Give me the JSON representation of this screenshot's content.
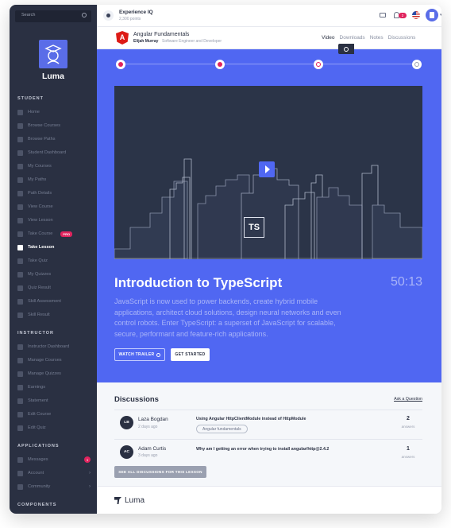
{
  "sidebar": {
    "search_placeholder": "Search",
    "logo_name": "Luma",
    "sections": {
      "student": "STUDENT",
      "instructor": "INSTRUCTOR",
      "applications": "APPLICATIONS",
      "components": "COMPONENTS"
    },
    "student_items": [
      {
        "label": "Home"
      },
      {
        "label": "Browse Courses"
      },
      {
        "label": "Browse Paths"
      },
      {
        "label": "Student Dashboard"
      },
      {
        "label": "My Courses"
      },
      {
        "label": "My Paths"
      },
      {
        "label": "Path Details"
      },
      {
        "label": "View Course"
      },
      {
        "label": "View Lesson"
      },
      {
        "label": "Take Course",
        "badge": "PRO"
      },
      {
        "label": "Take Lesson",
        "active": true
      },
      {
        "label": "Take Quiz"
      },
      {
        "label": "My Quizzes"
      },
      {
        "label": "Quiz Result"
      },
      {
        "label": "Skill Assessment"
      },
      {
        "label": "Skill Result"
      }
    ],
    "instructor_items": [
      {
        "label": "Instructor Dashboard"
      },
      {
        "label": "Manage Courses"
      },
      {
        "label": "Manage Quizzes"
      },
      {
        "label": "Earnings"
      },
      {
        "label": "Statement"
      },
      {
        "label": "Edit Course"
      },
      {
        "label": "Edit Quiz"
      }
    ],
    "application_items": [
      {
        "label": "Messages",
        "count": "3"
      },
      {
        "label": "Account"
      },
      {
        "label": "Community"
      }
    ]
  },
  "topbar": {
    "brand_title": "Experience IQ",
    "brand_sub": "2,300 points",
    "notification_count": "2"
  },
  "lesson": {
    "logo_letter": "A",
    "course_title": "Angular Fundamentals",
    "author": "Elijah Murray",
    "author_role": "Software Engineer and Developer",
    "tabs": [
      "Video",
      "Downloads",
      "Notes",
      "Discussions"
    ]
  },
  "hero": {
    "ts_label": "TS",
    "title": "Introduction to TypeScript",
    "duration": "50:13",
    "description": "JavaScript is now used to power backends, create hybrid mobile applications, architect cloud solutions, design neural networks and even control robots. Enter TypeScript: a superset of JavaScript for scalable, secure, performant and feature-rich applications.",
    "watch_trailer": "WATCH TRAILER",
    "get_started": "GET STARTED"
  },
  "discussions": {
    "title": "Discussions",
    "ask": "Ask a Question",
    "items": [
      {
        "initials": "LB",
        "name": "Laza Bogdan",
        "time": "2 days ago",
        "question": "Using Angular HttpClientModule instead of HttpModule",
        "tag": "Angular fundamentals",
        "count": "2",
        "count_label": "answers"
      },
      {
        "initials": "AC",
        "name": "Adam Curtis",
        "time": "3 days ago",
        "question": "Why am I getting an error when trying to install angular/http@2.4.2",
        "count": "1",
        "count_label": "answers"
      }
    ],
    "see_all": "SEE ALL DISCUSSIONS FOR THIS LESSON"
  },
  "footer": {
    "logo": "Luma"
  },
  "colors": {
    "sidebar_bg": "#2a3042",
    "accent": "#5067f2",
    "badge": "#e0245e"
  }
}
